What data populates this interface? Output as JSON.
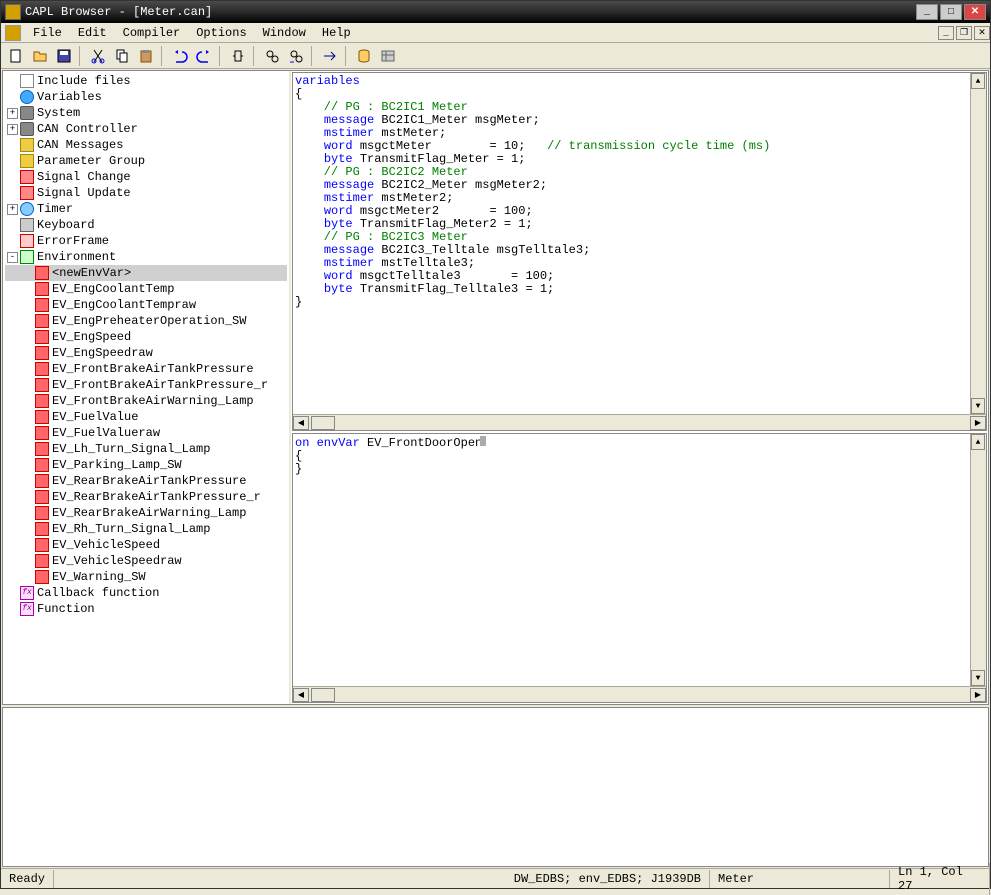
{
  "title": "CAPL Browser - [Meter.can]",
  "menu": [
    "File",
    "Edit",
    "Compiler",
    "Options",
    "Window",
    "Help"
  ],
  "tree": [
    {
      "lvl": 0,
      "exp": "",
      "icon": "doc",
      "label": "Include files"
    },
    {
      "lvl": 0,
      "exp": "",
      "icon": "globe",
      "label": "Variables"
    },
    {
      "lvl": 0,
      "exp": "+",
      "icon": "gear",
      "label": "System"
    },
    {
      "lvl": 0,
      "exp": "+",
      "icon": "gear",
      "label": "CAN Controller"
    },
    {
      "lvl": 0,
      "exp": "",
      "icon": "msg",
      "label": "CAN Messages"
    },
    {
      "lvl": 0,
      "exp": "",
      "icon": "msg",
      "label": "Parameter Group"
    },
    {
      "lvl": 0,
      "exp": "",
      "icon": "sig",
      "label": "Signal Change"
    },
    {
      "lvl": 0,
      "exp": "",
      "icon": "sig",
      "label": "Signal Update"
    },
    {
      "lvl": 0,
      "exp": "+",
      "icon": "timer",
      "label": "Timer"
    },
    {
      "lvl": 0,
      "exp": "",
      "icon": "kb",
      "label": "Keyboard"
    },
    {
      "lvl": 0,
      "exp": "",
      "icon": "err",
      "label": "ErrorFrame"
    },
    {
      "lvl": 0,
      "exp": "-",
      "icon": "env",
      "label": "Environment"
    },
    {
      "lvl": 1,
      "exp": "",
      "icon": "envvar",
      "label": "<newEnvVar>",
      "sel": true
    },
    {
      "lvl": 1,
      "exp": "",
      "icon": "envvar",
      "label": "EV_EngCoolantTemp"
    },
    {
      "lvl": 1,
      "exp": "",
      "icon": "envvar",
      "label": "EV_EngCoolantTempraw"
    },
    {
      "lvl": 1,
      "exp": "",
      "icon": "envvar",
      "label": "EV_EngPreheaterOperation_SW"
    },
    {
      "lvl": 1,
      "exp": "",
      "icon": "envvar",
      "label": "EV_EngSpeed"
    },
    {
      "lvl": 1,
      "exp": "",
      "icon": "envvar",
      "label": "EV_EngSpeedraw"
    },
    {
      "lvl": 1,
      "exp": "",
      "icon": "envvar",
      "label": "EV_FrontBrakeAirTankPressure"
    },
    {
      "lvl": 1,
      "exp": "",
      "icon": "envvar",
      "label": "EV_FrontBrakeAirTankPressure_r"
    },
    {
      "lvl": 1,
      "exp": "",
      "icon": "envvar",
      "label": "EV_FrontBrakeAirWarning_Lamp"
    },
    {
      "lvl": 1,
      "exp": "",
      "icon": "envvar",
      "label": "EV_FuelValue"
    },
    {
      "lvl": 1,
      "exp": "",
      "icon": "envvar",
      "label": "EV_FuelValueraw"
    },
    {
      "lvl": 1,
      "exp": "",
      "icon": "envvar",
      "label": "EV_Lh_Turn_Signal_Lamp"
    },
    {
      "lvl": 1,
      "exp": "",
      "icon": "envvar",
      "label": "EV_Parking_Lamp_SW"
    },
    {
      "lvl": 1,
      "exp": "",
      "icon": "envvar",
      "label": "EV_RearBrakeAirTankPressure"
    },
    {
      "lvl": 1,
      "exp": "",
      "icon": "envvar",
      "label": "EV_RearBrakeAirTankPressure_r"
    },
    {
      "lvl": 1,
      "exp": "",
      "icon": "envvar",
      "label": "EV_RearBrakeAirWarning_Lamp"
    },
    {
      "lvl": 1,
      "exp": "",
      "icon": "envvar",
      "label": "EV_Rh_Turn_Signal_Lamp"
    },
    {
      "lvl": 1,
      "exp": "",
      "icon": "envvar",
      "label": "EV_VehicleSpeed"
    },
    {
      "lvl": 1,
      "exp": "",
      "icon": "envvar",
      "label": "EV_VehicleSpeedraw"
    },
    {
      "lvl": 1,
      "exp": "",
      "icon": "envvar",
      "label": "EV_Warning_SW"
    },
    {
      "lvl": 0,
      "exp": "",
      "icon": "fn",
      "label": "Callback function"
    },
    {
      "lvl": 0,
      "exp": "",
      "icon": "fn",
      "label": "Function"
    }
  ],
  "code_top": [
    [
      {
        "t": "variables",
        "c": "kw-blue"
      }
    ],
    [
      {
        "t": "{",
        "c": "kw-dark"
      }
    ],
    [
      {
        "t": "    // PG : BC2IC1 Meter",
        "c": "kw-green"
      }
    ],
    [
      {
        "t": "    ",
        "c": ""
      },
      {
        "t": "message",
        "c": "kw-blue"
      },
      {
        "t": " BC2IC1_Meter msgMeter;",
        "c": "kw-dark"
      }
    ],
    [
      {
        "t": "    ",
        "c": ""
      },
      {
        "t": "mstimer",
        "c": "kw-blue"
      },
      {
        "t": " mstMeter;",
        "c": "kw-dark"
      }
    ],
    [
      {
        "t": "    ",
        "c": ""
      },
      {
        "t": "word",
        "c": "kw-blue"
      },
      {
        "t": " msgctMeter        = 10;   ",
        "c": "kw-dark"
      },
      {
        "t": "// transmission cycle time (ms)",
        "c": "kw-green"
      }
    ],
    [
      {
        "t": "    ",
        "c": ""
      },
      {
        "t": "byte",
        "c": "kw-blue"
      },
      {
        "t": " TransmitFlag_Meter = 1;",
        "c": "kw-dark"
      }
    ],
    [
      {
        "t": "",
        "c": ""
      }
    ],
    [
      {
        "t": "    // PG : BC2IC2 Meter",
        "c": "kw-green"
      }
    ],
    [
      {
        "t": "    ",
        "c": ""
      },
      {
        "t": "message",
        "c": "kw-blue"
      },
      {
        "t": " BC2IC2_Meter msgMeter2;",
        "c": "kw-dark"
      }
    ],
    [
      {
        "t": "    ",
        "c": ""
      },
      {
        "t": "mstimer",
        "c": "kw-blue"
      },
      {
        "t": " mstMeter2;",
        "c": "kw-dark"
      }
    ],
    [
      {
        "t": "    ",
        "c": ""
      },
      {
        "t": "word",
        "c": "kw-blue"
      },
      {
        "t": " msgctMeter2       = 100;",
        "c": "kw-dark"
      }
    ],
    [
      {
        "t": "    ",
        "c": ""
      },
      {
        "t": "byte",
        "c": "kw-blue"
      },
      {
        "t": " TransmitFlag_Meter2 = 1;",
        "c": "kw-dark"
      }
    ],
    [
      {
        "t": "",
        "c": ""
      }
    ],
    [
      {
        "t": "    // PG : BC2IC3 Meter",
        "c": "kw-green"
      }
    ],
    [
      {
        "t": "    ",
        "c": ""
      },
      {
        "t": "message",
        "c": "kw-blue"
      },
      {
        "t": " BC2IC3_Telltale msgTelltale3;",
        "c": "kw-dark"
      }
    ],
    [
      {
        "t": "    ",
        "c": ""
      },
      {
        "t": "mstimer",
        "c": "kw-blue"
      },
      {
        "t": " mstTelltale3;",
        "c": "kw-dark"
      }
    ],
    [
      {
        "t": "    ",
        "c": ""
      },
      {
        "t": "word",
        "c": "kw-blue"
      },
      {
        "t": " msgctTelltale3       = 100;",
        "c": "kw-dark"
      }
    ],
    [
      {
        "t": "    ",
        "c": ""
      },
      {
        "t": "byte",
        "c": "kw-blue"
      },
      {
        "t": " TransmitFlag_Telltale3 = 1;",
        "c": "kw-dark"
      }
    ],
    [
      {
        "t": "",
        "c": ""
      }
    ],
    [
      {
        "t": "}",
        "c": "kw-dark"
      }
    ]
  ],
  "code_bottom": [
    [
      {
        "t": "on envVar",
        "c": "kw-blue"
      },
      {
        "t": " EV_FrontDoorOpen",
        "c": "kw-dark"
      }
    ],
    [
      {
        "t": "{",
        "c": "kw-dark"
      }
    ],
    [
      {
        "t": "}",
        "c": "kw-dark"
      }
    ]
  ],
  "status": {
    "ready": "Ready",
    "db": "DW_EDBS; env_EDBS; J1939DB",
    "mod": "Meter",
    "pos": "Ln 1, Col 27"
  }
}
